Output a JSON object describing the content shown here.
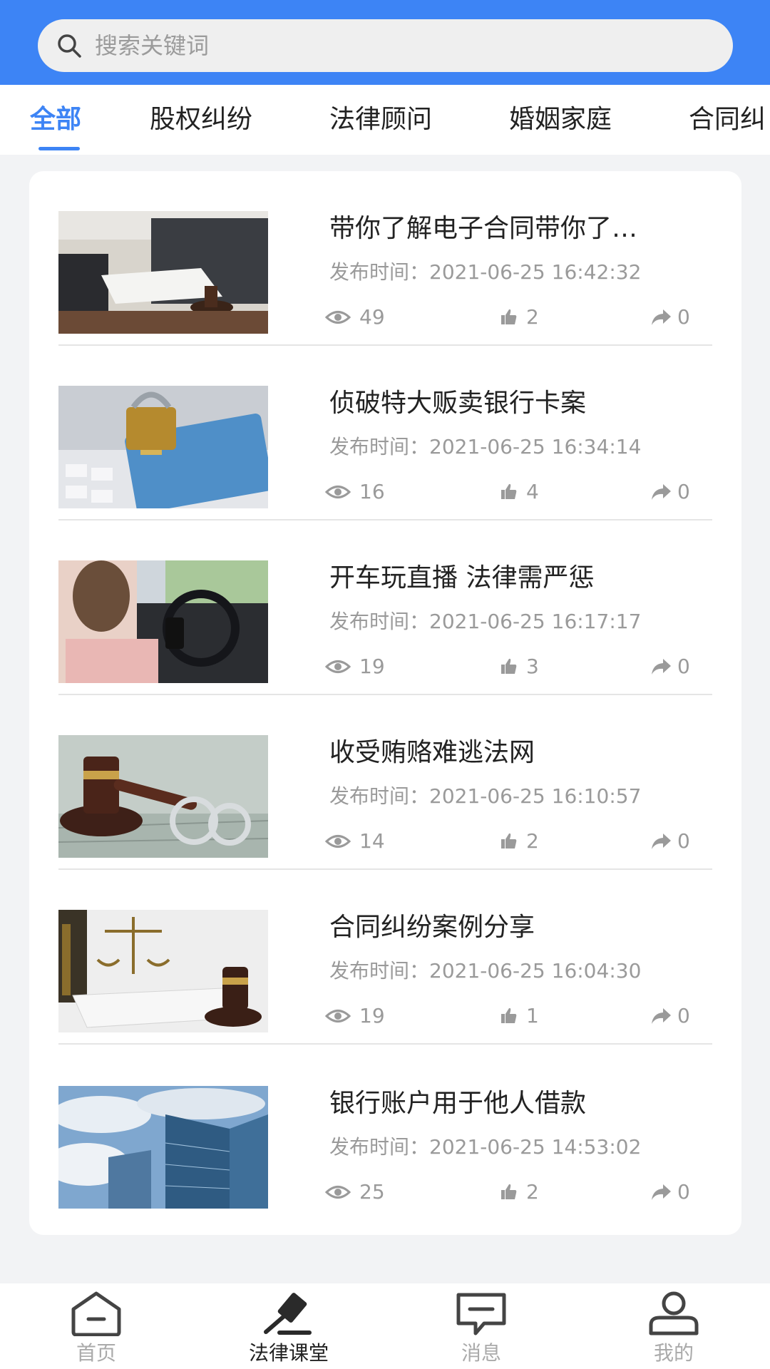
{
  "search": {
    "placeholder": "搜索关键词",
    "icon": "search-icon"
  },
  "tabs": [
    {
      "label": "全部",
      "active": true
    },
    {
      "label": "股权纠纷",
      "active": false
    },
    {
      "label": "法律顾问",
      "active": false
    },
    {
      "label": "婚姻家庭",
      "active": false
    },
    {
      "label": "合同纠",
      "active": false
    }
  ],
  "articles": [
    {
      "title": "带你了解电子合同带你了…",
      "time": "发布时间：2021-06-25 16:42:32",
      "views": "49",
      "likes": "2",
      "shares": "0"
    },
    {
      "title": "侦破特大贩卖银行卡案",
      "time": "发布时间：2021-06-25 16:34:14",
      "views": "16",
      "likes": "4",
      "shares": "0"
    },
    {
      "title": "开车玩直播 法律需严惩",
      "time": "发布时间：2021-06-25 16:17:17",
      "views": "19",
      "likes": "3",
      "shares": "0"
    },
    {
      "title": "收受贿赂难逃法网",
      "time": "发布时间：2021-06-25 16:10:57",
      "views": "14",
      "likes": "2",
      "shares": "0"
    },
    {
      "title": "合同纠纷案例分享",
      "time": "发布时间：2021-06-25 16:04:30",
      "views": "19",
      "likes": "1",
      "shares": "0"
    },
    {
      "title": "银行账户用于他人借款",
      "time": "发布时间：2021-06-25 14:53:02",
      "views": "25",
      "likes": "2",
      "shares": "0"
    }
  ],
  "bottom_nav": [
    {
      "label": "首页",
      "icon": "home-icon",
      "active": false
    },
    {
      "label": "法律课堂",
      "icon": "gavel-icon",
      "active": true
    },
    {
      "label": "消息",
      "icon": "message-icon",
      "active": false
    },
    {
      "label": "我的",
      "icon": "user-icon",
      "active": false
    }
  ],
  "colors": {
    "accent": "#3d84f5",
    "muted": "#9a9a9a",
    "text": "#222222"
  }
}
